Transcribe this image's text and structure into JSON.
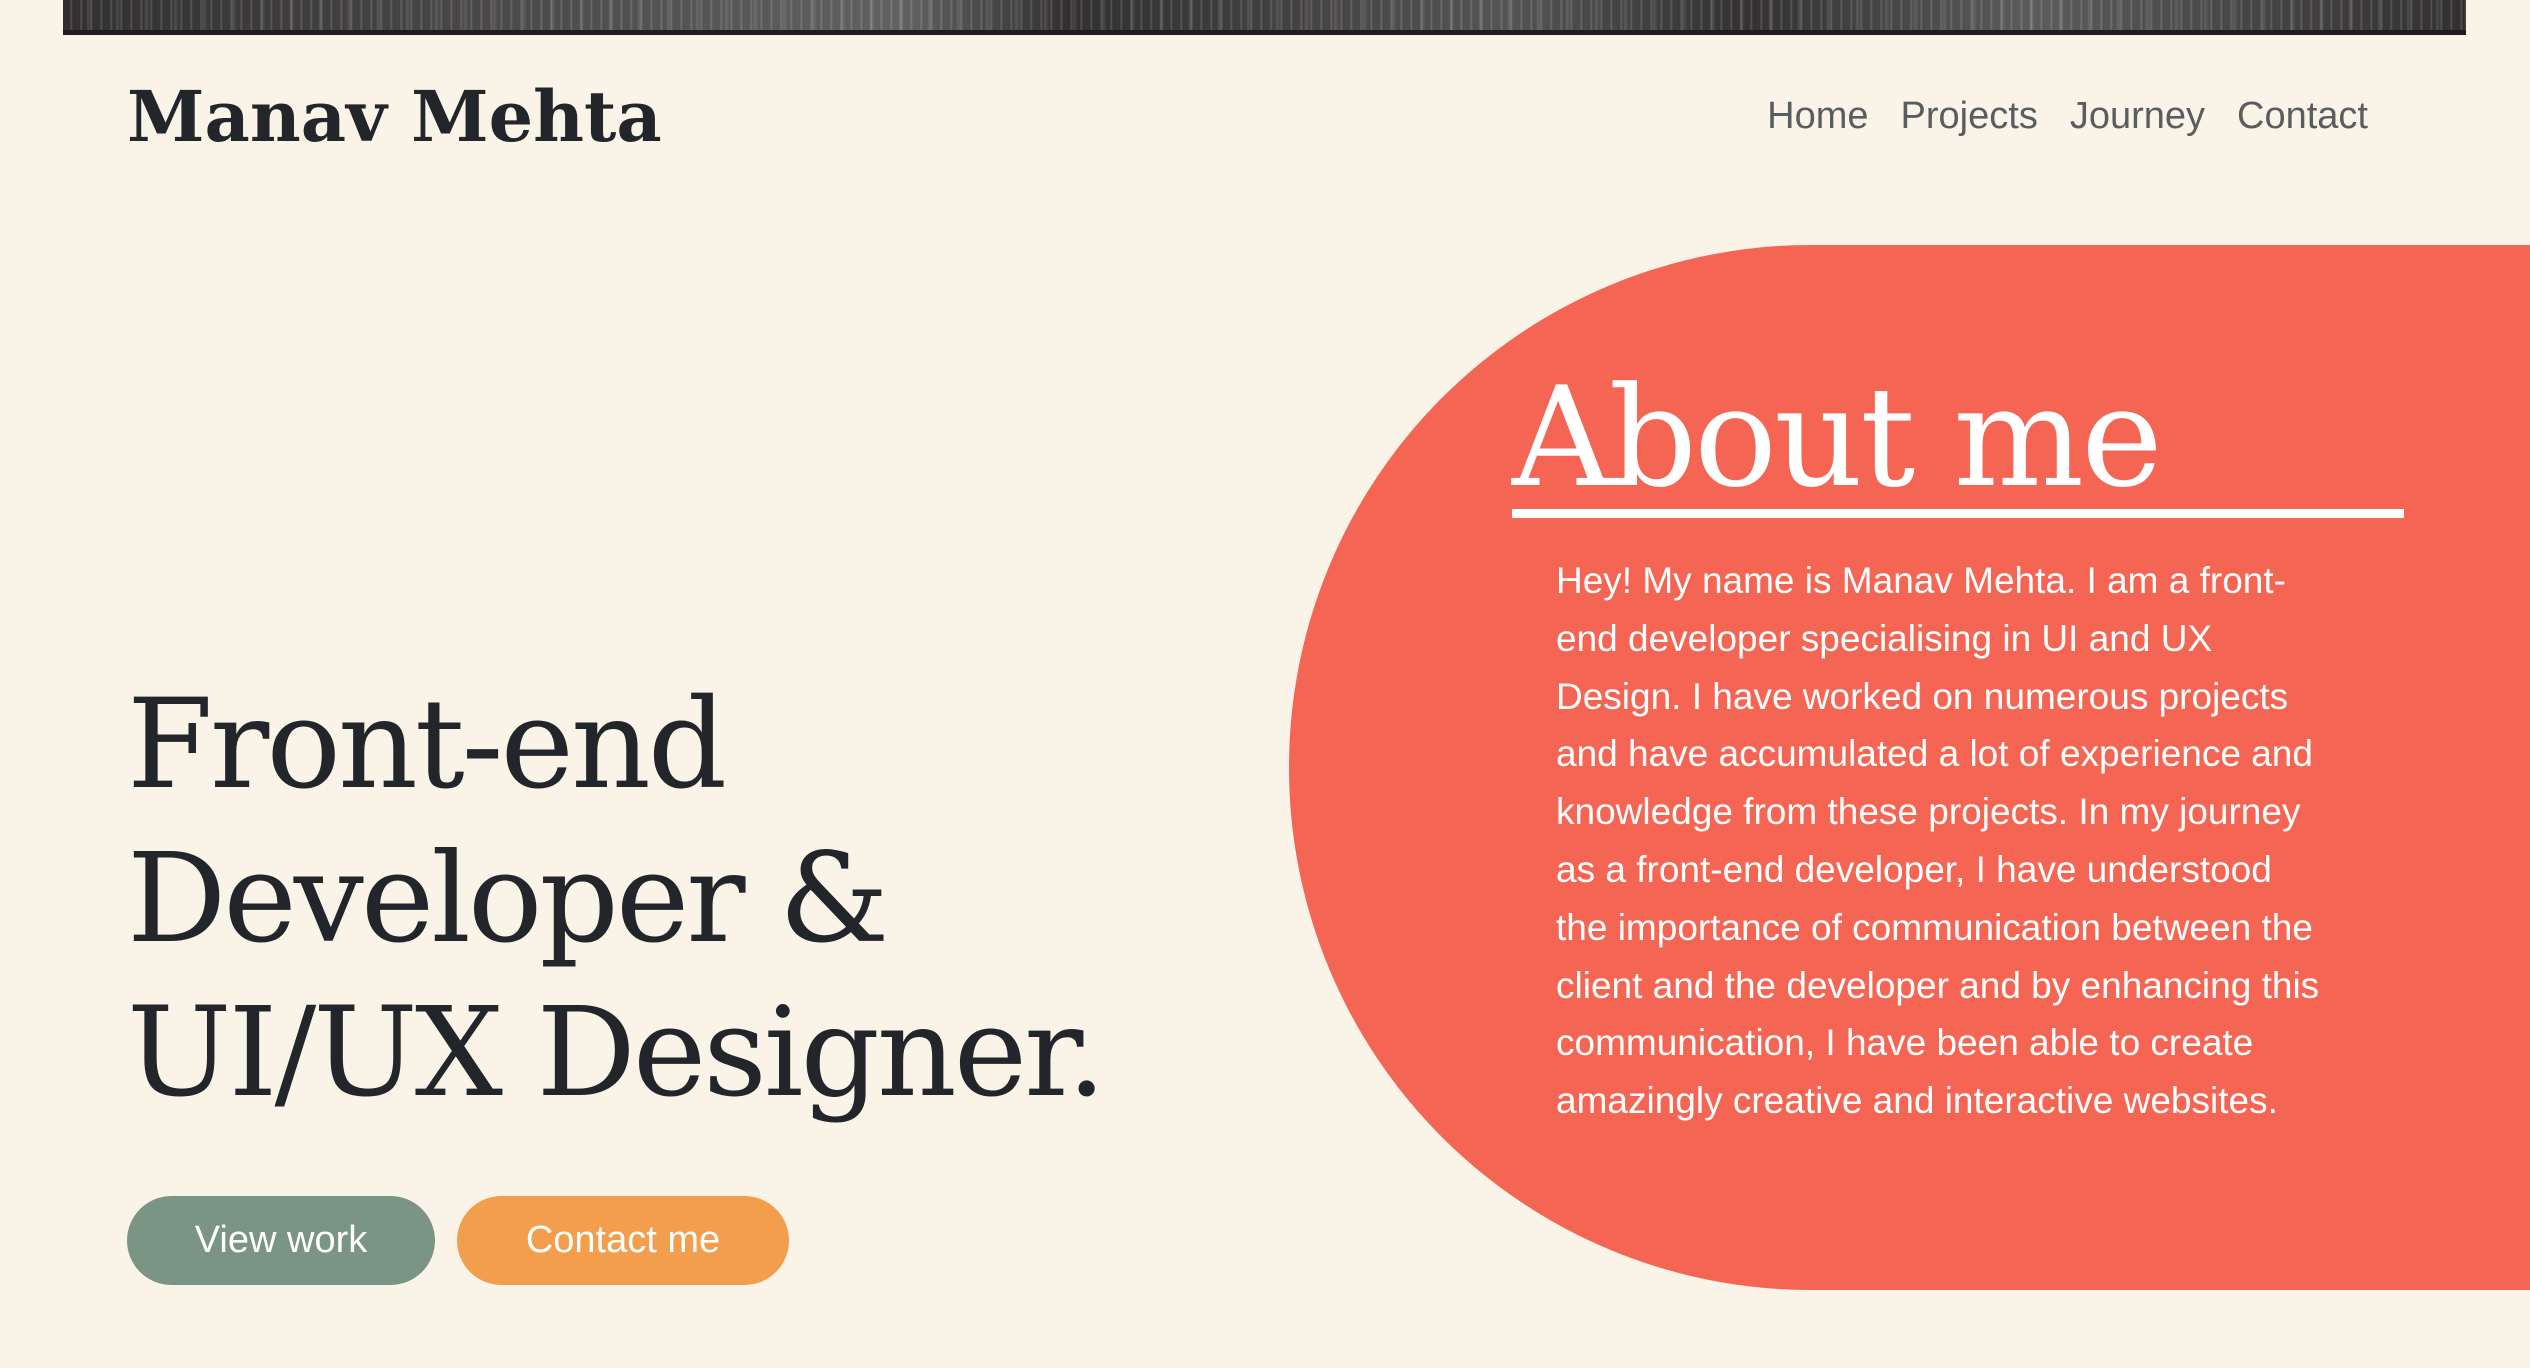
{
  "header": {
    "logo": "Manav Mehta",
    "nav": [
      "Home",
      "Projects",
      "Journey",
      "Contact"
    ]
  },
  "hero": {
    "headline_lines": [
      "Front-end",
      "Developer &",
      "UI/UX Designer."
    ],
    "buttons": {
      "view_work": "View work",
      "contact_me": "Contact me"
    }
  },
  "about": {
    "title": "About me",
    "text_lines": [
      "Hey! My name is Manav Mehta. I am a front-",
      "end developer specialising in UI and UX",
      "Design. I have worked on numerous projects",
      "and have accumulated a lot of experience and",
      "knowledge from these projects. In my journey",
      "as a front-end developer, I have understood",
      "the importance of communication between the",
      "client and the developer and by enhancing this",
      "communication, I have been able to create",
      "amazingly creative and interactive websites."
    ]
  },
  "colors": {
    "background": "#faf3e7",
    "text_dark": "#22262b",
    "nav_text": "#5a5d5f",
    "accent_coral": "#f46554",
    "button_green": "#7a9584",
    "button_orange": "#f29e4c",
    "top_bar": "#262424"
  }
}
